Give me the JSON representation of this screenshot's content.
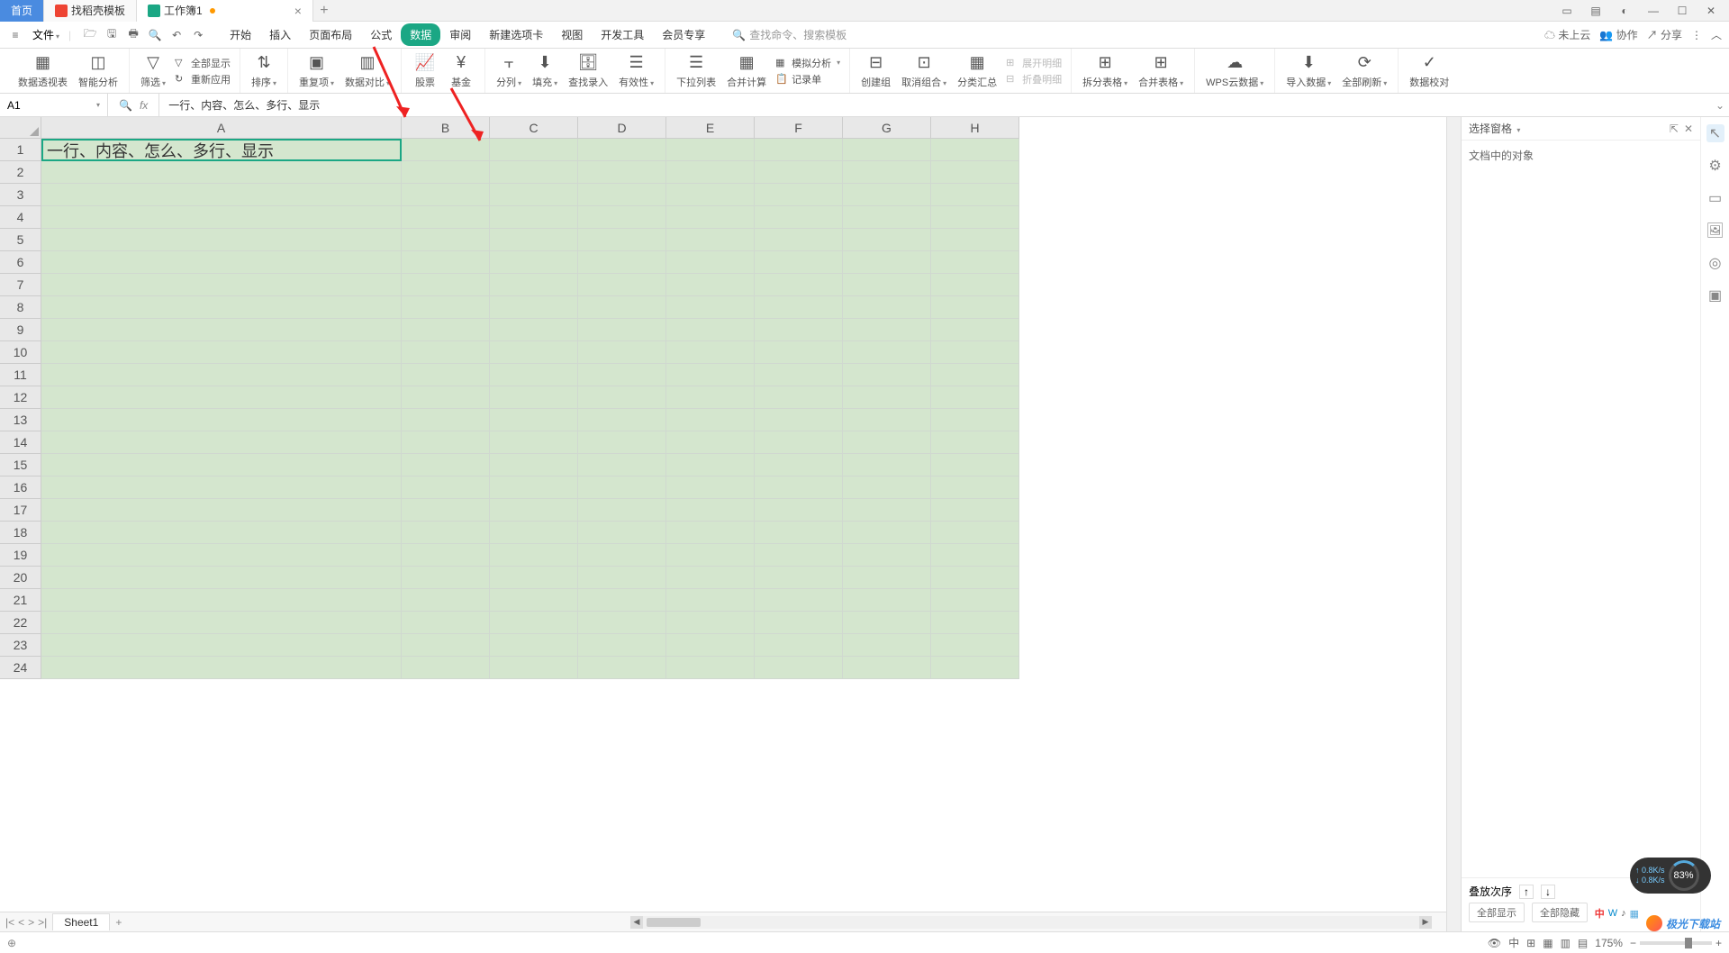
{
  "titlebar": {
    "tabs": {
      "home": "首页",
      "template": "找稻壳模板",
      "workbook": "工作簿1"
    }
  },
  "menubar": {
    "file": "文件",
    "tabs": {
      "start": "开始",
      "insert": "插入",
      "pagelayout": "页面布局",
      "formula": "公式",
      "data": "数据",
      "review": "审阅",
      "newtab": "新建选项卡",
      "view": "视图",
      "devtools": "开发工具",
      "member": "会员专享"
    },
    "search_placeholder": "查找命令、搜索模板",
    "right": {
      "cloud": "未上云",
      "collab": "协作",
      "share": "分享"
    }
  },
  "ribbon": {
    "pivot": "数据透视表",
    "smart": "智能分析",
    "filter": "筛选",
    "allshow": "全部显示",
    "reapply": "重新应用",
    "sort": "排序",
    "dup": "重复项",
    "compare": "数据对比",
    "stock": "股票",
    "fund": "基金",
    "split": "分列",
    "fill": "填充",
    "search_input": "查找录入",
    "validity": "有效性",
    "dropdown": "下拉列表",
    "consolidate": "合并计算",
    "record": "记录单",
    "group": "创建组",
    "ungroup": "取消组合",
    "subtotal": "分类汇总",
    "expand": "展开明细",
    "collapse": "折叠明细",
    "split_table": "拆分表格",
    "merge_table": "合并表格",
    "wps_cloud": "WPS云数据",
    "import": "导入数据",
    "refresh": "全部刷新",
    "validate": "数据校对"
  },
  "formula_bar": {
    "name_box": "A1",
    "content": "一行、内容、怎么、多行、显示"
  },
  "columns": [
    "A",
    "B",
    "C",
    "D",
    "E",
    "F",
    "G",
    "H"
  ],
  "rows_count": 24,
  "cell_a1": "一行、内容、怎么、多行、显示",
  "right_panel": {
    "title": "选择窗格",
    "subtitle": "文档中的对象",
    "stack_order": "叠放次序",
    "show_all": "全部显示",
    "hide_all": "全部隐藏"
  },
  "sheet_tabs": {
    "sheet1": "Sheet1"
  },
  "statusbar": {
    "zoom": "175%",
    "net_up": "0.8K/s",
    "net_down": "0.8K/s",
    "gauge": "83%"
  },
  "watermark": "极光下载站",
  "ime": "中"
}
